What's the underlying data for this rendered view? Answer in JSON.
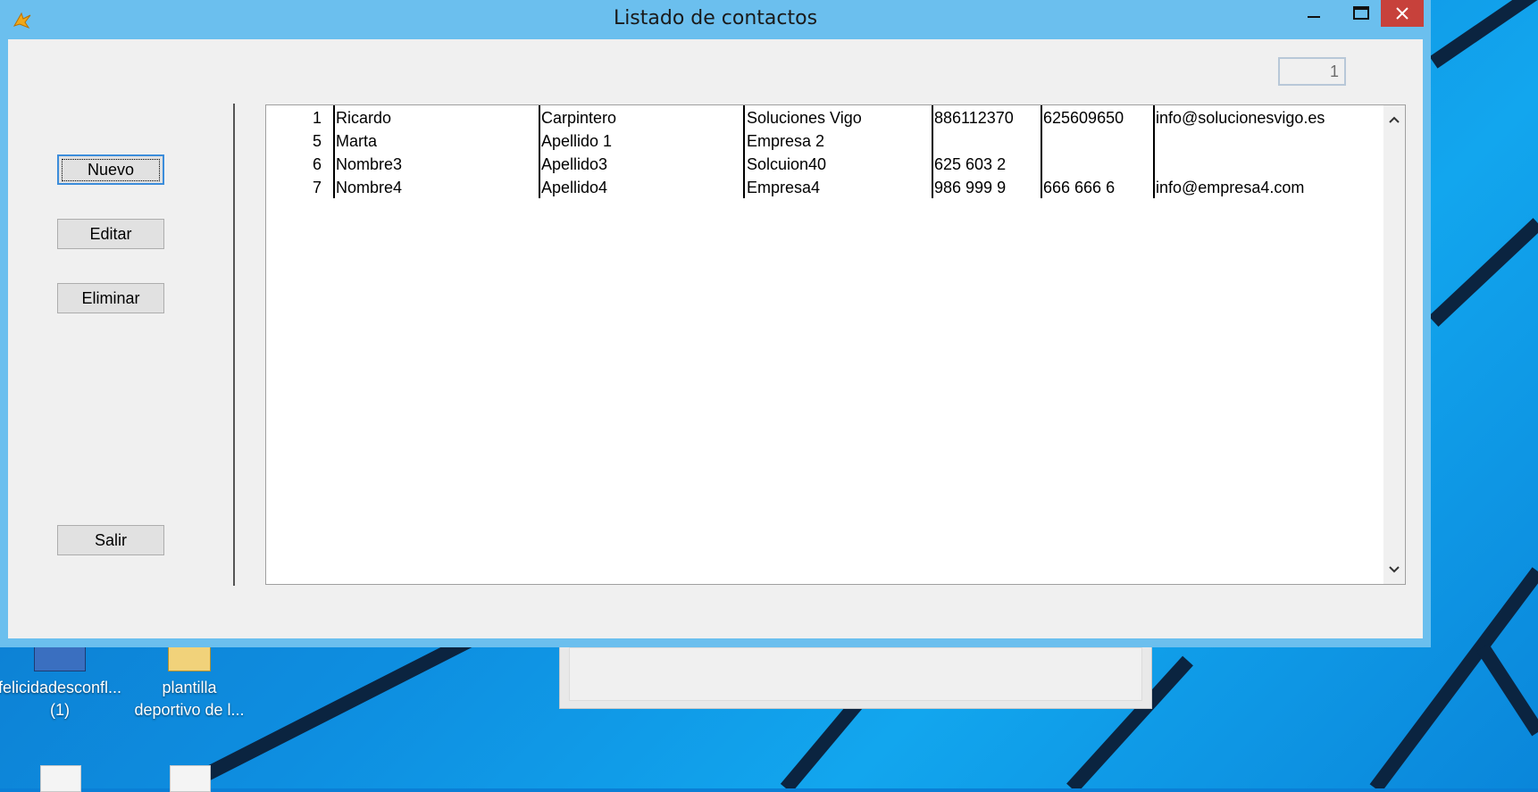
{
  "window": {
    "title": "Listado de contactos"
  },
  "toolbar": {
    "nuevo": "Nuevo",
    "editar": "Editar",
    "eliminar": "Eliminar",
    "salir": "Salir"
  },
  "counter": "1",
  "contacts": [
    {
      "id": "1",
      "nombre": "Ricardo",
      "apellido": "Carpintero",
      "empresa": "Soluciones Vigo",
      "tel1": "886112370",
      "tel2": "625609650",
      "email": "info@solucionesvigo.es"
    },
    {
      "id": "5",
      "nombre": "Marta",
      "apellido": "Apellido 1",
      "empresa": "Empresa 2",
      "tel1": "",
      "tel2": "",
      "email": ""
    },
    {
      "id": "6",
      "nombre": "Nombre3",
      "apellido": "Apellido3",
      "empresa": "Solcuion40",
      "tel1": "625 603 2",
      "tel2": "",
      "email": ""
    },
    {
      "id": "7",
      "nombre": "Nombre4",
      "apellido": "Apellido4",
      "empresa": "Empresa4",
      "tel1": "986 999 9",
      "tel2": "666 666 6",
      "email": "info@empresa4.com"
    }
  ],
  "desktop": {
    "icon1": {
      "line1": "felicidadesconfl...",
      "line2": "(1)"
    },
    "icon2": {
      "line1": "plantilla",
      "line2": "deportivo de l..."
    }
  },
  "colors": {
    "titlebar": "#6bbfee",
    "close": "#c7413b",
    "focus": "#3c8ddb"
  },
  "icons": {
    "app": "java-duke-icon",
    "minimize": "minimize-icon",
    "maximize": "maximize-icon",
    "close": "close-icon",
    "scroll_up": "chevron-up-icon",
    "scroll_down": "chevron-down-icon"
  }
}
